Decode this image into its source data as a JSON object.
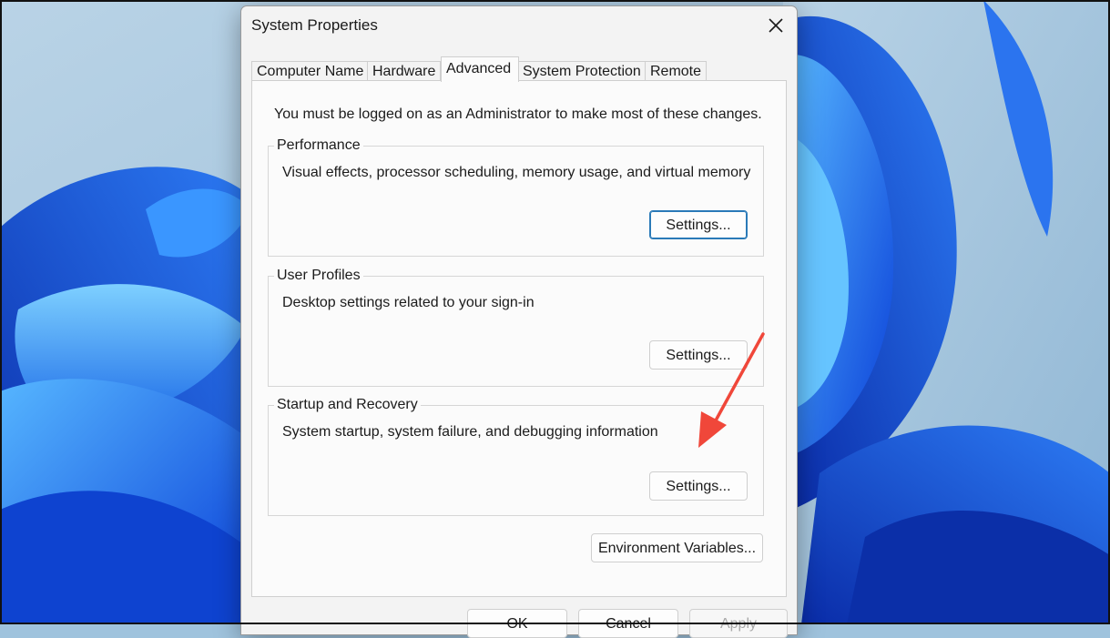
{
  "dialog": {
    "title": "System Properties",
    "tabs": [
      {
        "label": "Computer Name",
        "active": false
      },
      {
        "label": "Hardware",
        "active": false
      },
      {
        "label": "Advanced",
        "active": true
      },
      {
        "label": "System Protection",
        "active": false
      },
      {
        "label": "Remote",
        "active": false
      }
    ],
    "admin_note": "You must be logged on as an Administrator to make most of these changes.",
    "groups": {
      "performance": {
        "legend": "Performance",
        "description": "Visual effects, processor scheduling, memory usage, and virtual memory",
        "button": "Settings..."
      },
      "user_profiles": {
        "legend": "User Profiles",
        "description": "Desktop settings related to your sign-in",
        "button": "Settings..."
      },
      "startup_recovery": {
        "legend": "Startup and Recovery",
        "description": "System startup, system failure, and debugging information",
        "button": "Settings..."
      }
    },
    "env_vars_button": "Environment Variables...",
    "footer": {
      "ok": "OK",
      "cancel": "Cancel",
      "apply": "Apply"
    }
  },
  "icons": {
    "close": "close-icon"
  },
  "colors": {
    "accent_border": "#2a7ab8",
    "annotation_arrow": "#f0473a",
    "wallpaper_base": "#9fc3dd"
  }
}
